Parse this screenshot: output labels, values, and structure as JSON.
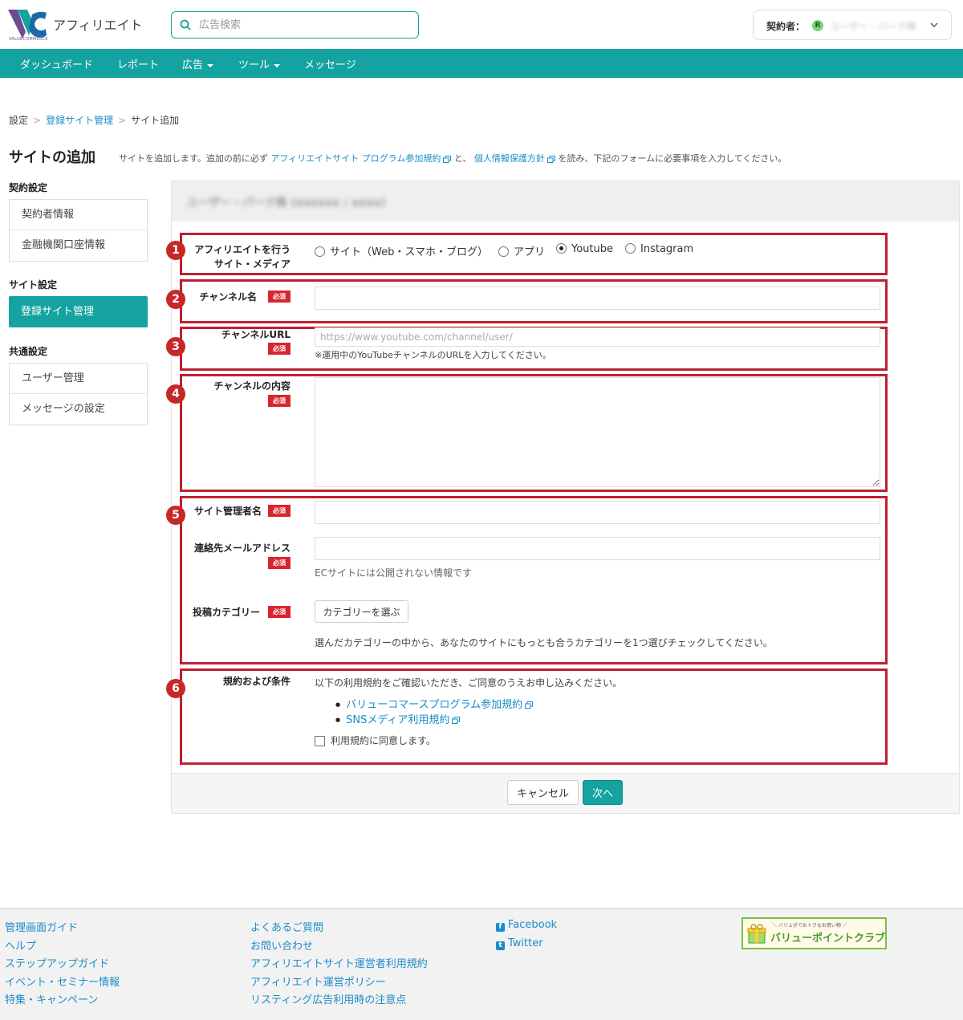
{
  "header": {
    "app_title": "アフィリエイト",
    "logo_text": "VALUECOMMERCE",
    "search_placeholder": "広告検索",
    "account_label": "契約者：",
    "account_rank": "R",
    "account_name": "ユーザー・パーク株"
  },
  "nav": {
    "items": [
      {
        "label": "ダッシュボード",
        "dropdown": false
      },
      {
        "label": "レポート",
        "dropdown": false
      },
      {
        "label": "広告",
        "dropdown": true
      },
      {
        "label": "ツール",
        "dropdown": true
      },
      {
        "label": "メッセージ",
        "dropdown": false
      }
    ]
  },
  "breadcrumb": {
    "items": [
      "設定",
      "登録サイト管理",
      "サイト追加"
    ],
    "separator": ">"
  },
  "page": {
    "title": "サイトの追加",
    "desc_pre": "サイトを追加します。追加の前に必ず",
    "desc_link1": "アフィリエイトサイト プログラム参加規約",
    "desc_mid": "と、",
    "desc_link2": "個人情報保護方針",
    "desc_post": "を読み、下記のフォームに必要事項を入力してください。"
  },
  "sidebar": {
    "contract_heading": "契約設定",
    "contract_items": [
      "契約者情報",
      "金融機関口座情報"
    ],
    "site_heading": "サイト設定",
    "site_active": "登録サイト管理",
    "common_heading": "共通設定",
    "common_items": [
      "ユーザー管理",
      "メッセージの設定"
    ]
  },
  "panel": {
    "header_text": "ユーザー・パーク株 (xxxxxx / xxxx)"
  },
  "required_label": "必須",
  "badges": [
    "1",
    "2",
    "3",
    "4",
    "5",
    "6"
  ],
  "form": {
    "media_label_line1": "アフィリエイトを行う",
    "media_label_line2": "サイト・メディア",
    "media_options": [
      {
        "label": "サイト（Web・スマホ・ブログ）",
        "selected": false
      },
      {
        "label": "アプリ",
        "selected": false
      },
      {
        "label": "Youtube",
        "selected": true
      },
      {
        "label": "Instagram",
        "selected": false
      }
    ],
    "channel_name_label": "チャンネル名",
    "channel_url_label": "チャンネルURL",
    "channel_url_placeholder": "https://www.youtube.com/channel/user/",
    "channel_url_hint": "※運用中のYouTubeチャンネルのURLを入力してください。",
    "channel_content_label": "チャンネルの内容",
    "admin_name_label": "サイト管理者名",
    "email_label": "連絡先メールアドレス",
    "email_hint": "ECサイトには公開されない情報です",
    "category_label": "投稿カテゴリー",
    "category_button": "カテゴリーを選ぶ",
    "category_hint": "選んだカテゴリーの中から、あなたのサイトにもっとも合うカテゴリーを1つ選びチェックしてください。",
    "terms_label": "規約および条件",
    "terms_intro": "以下の利用規約をご確認いただき、ご同意のうえお申し込みください。",
    "terms_links": [
      "バリューコマースプログラム参加規約",
      "SNSメディア利用規約"
    ],
    "terms_agree": "利用規約に同意します。",
    "terms_agree_checked": false
  },
  "actions": {
    "cancel": "キャンセル",
    "next": "次へ"
  },
  "footer": {
    "col1": [
      "管理画面ガイド",
      "ヘルプ",
      "ステップアップガイド",
      "イベント・セミナー情報",
      "特集・キャンペーン"
    ],
    "col2": [
      "よくあるご質問",
      "お問い合わせ",
      "アフィリエイトサイト運営者利用規約",
      "アフィリエイト運営ポリシー",
      "リスティング広告利用時の注意点"
    ],
    "sns": [
      "Facebook",
      "Twitter"
    ],
    "banner_sub": "＼ バリュポでおトクなお買い物 ／",
    "banner_main": "バリューポイントクラブ"
  },
  "colors": {
    "brand_teal": "#14a3a0",
    "link_blue": "#1a8cc9",
    "highlight_red": "#c0202f",
    "required_red": "#d9252f"
  }
}
